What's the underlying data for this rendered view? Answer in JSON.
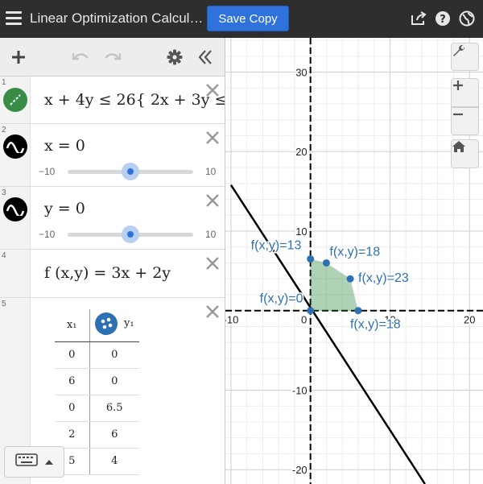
{
  "app": {
    "title": "Linear Optimization Calcul…",
    "save_label": "Save Copy"
  },
  "expressions": [
    {
      "number": "1",
      "text": "x + 4y ≤ 26{ 2x + 3y ≤"
    },
    {
      "number": "2",
      "text": "x = 0",
      "slider": {
        "min": "−10",
        "max": "10",
        "value": 0
      }
    },
    {
      "number": "3",
      "text": "y = 0",
      "slider": {
        "min": "−10",
        "max": "10",
        "value": 0
      }
    },
    {
      "number": "4",
      "text": "f (x,y) = 3x + 2y"
    },
    {
      "number": "5",
      "table": {
        "col1": "x₁",
        "col2": "y₁",
        "rows": [
          [
            "0",
            "0"
          ],
          [
            "6",
            "0"
          ],
          [
            "0",
            "6.5"
          ],
          [
            "2",
            "6"
          ],
          [
            "5",
            "4"
          ]
        ]
      }
    }
  ],
  "colors": {
    "topbar": "#2e2e2e",
    "save_button": "#2f72dc",
    "expr1_icon": "#388c46",
    "point_blue": "#2d70b3",
    "region_green": "#388c46"
  },
  "icons": {
    "menu": "hamburger-icon",
    "share": "share-icon",
    "help": "help-icon",
    "language": "globe-icon",
    "add": "plus-icon",
    "undo": "undo-icon",
    "redo": "redo-icon",
    "settings": "gear-icon",
    "collapse": "double-chevron-left-icon",
    "wrench": "wrench-icon",
    "zoom_in": "zoom-in-icon",
    "zoom_out": "zoom-out-icon",
    "home": "home-icon",
    "keyboard": "keyboard-icon"
  },
  "chart_data": {
    "type": "scatter",
    "x_ticks": [
      "-10",
      "0",
      "10",
      "20"
    ],
    "y_ticks": [
      "30",
      "20",
      "10",
      "-10",
      "-20"
    ],
    "xlim": [
      -10.7,
      21.7
    ],
    "ylim": [
      -21.8,
      34.3
    ],
    "grid": true,
    "feasible_region": [
      [
        0,
        0
      ],
      [
        6,
        0
      ],
      [
        5,
        4
      ],
      [
        2,
        6
      ],
      [
        0,
        6.5
      ]
    ],
    "line": {
      "description": "x = 0 through y = 0 line",
      "points": [
        [
          -10,
          15.8
        ],
        [
          14.4,
          -21.8
        ]
      ]
    },
    "points": [
      {
        "x": 0,
        "y": 0,
        "label": "f(x,y)=0"
      },
      {
        "x": 6,
        "y": 0,
        "label": "f(x,y)=18"
      },
      {
        "x": 5,
        "y": 4,
        "label": "f(x,y)=23"
      },
      {
        "x": 2,
        "y": 6,
        "label": "f(x,y)=18"
      },
      {
        "x": 0,
        "y": 6.5,
        "label": "f(x,y)=13"
      }
    ]
  }
}
